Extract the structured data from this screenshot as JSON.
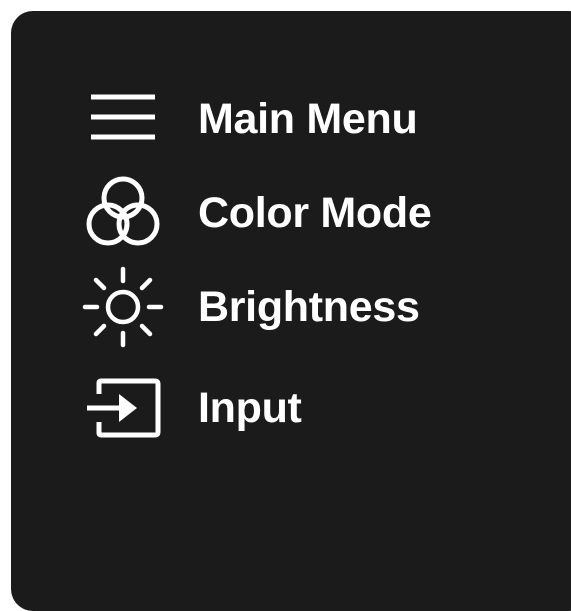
{
  "menu": {
    "items": [
      {
        "label": "Main Menu",
        "icon": "hamburger-menu-icon"
      },
      {
        "label": "Color Mode",
        "icon": "color-circles-icon"
      },
      {
        "label": "Brightness",
        "icon": "sun-brightness-icon"
      },
      {
        "label": "Input",
        "icon": "input-source-icon"
      }
    ]
  },
  "colors": {
    "panel_background": "#1b1b1b",
    "foreground": "#ffffff",
    "page_background": "#ffffff"
  }
}
